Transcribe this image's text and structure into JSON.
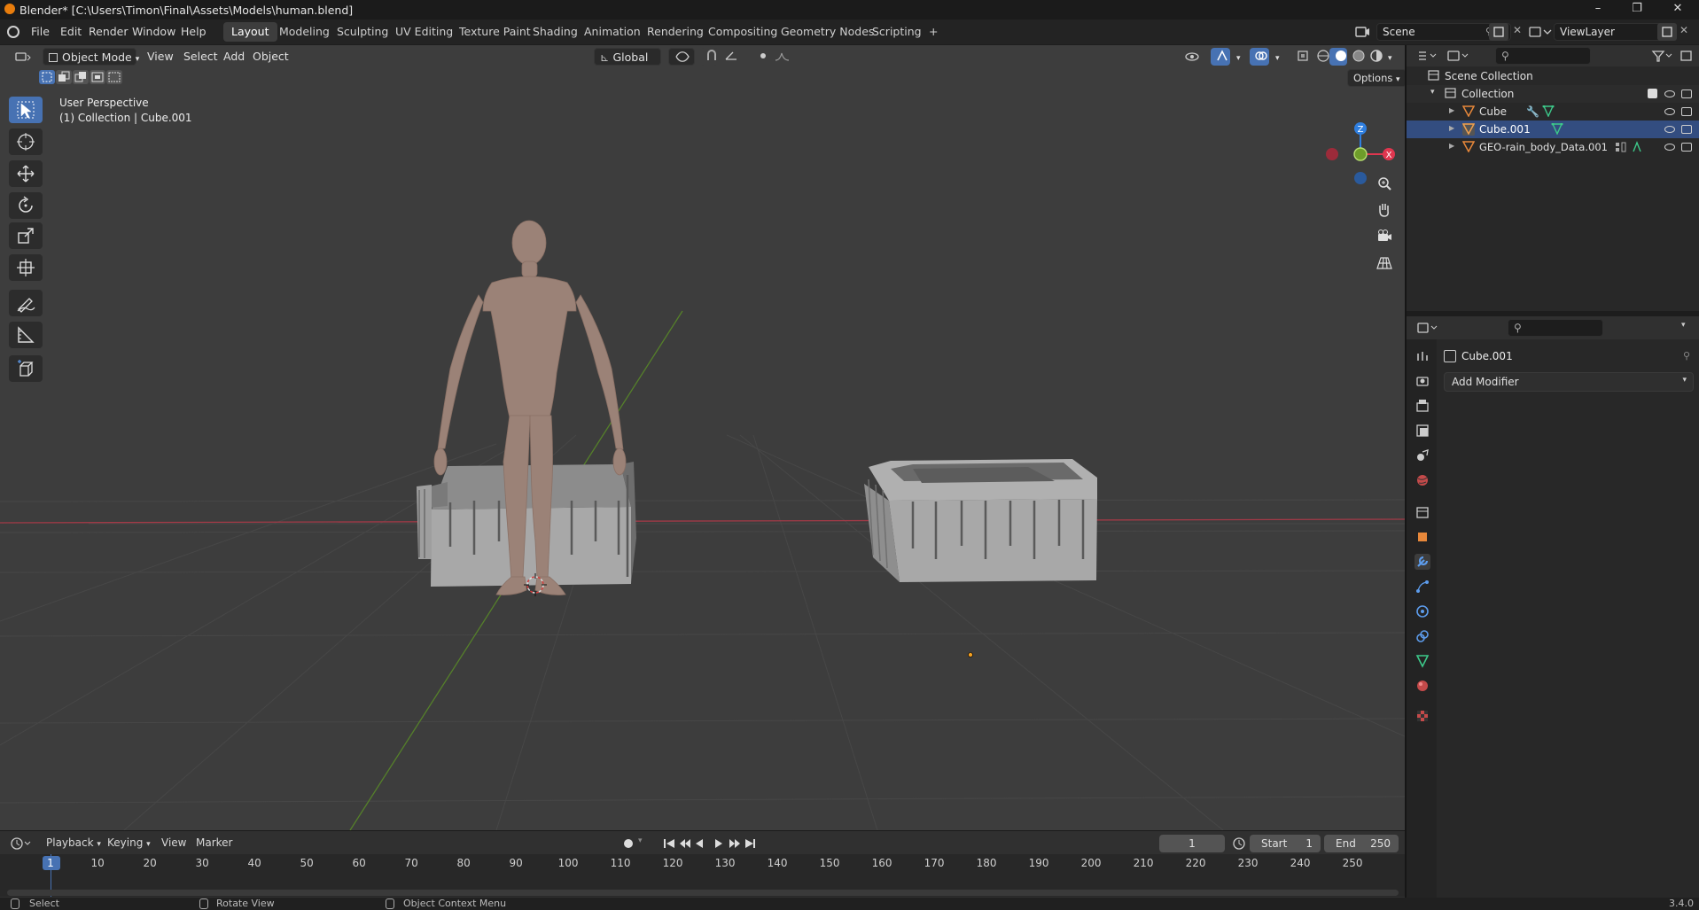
{
  "window": {
    "title": "Blender* [C:\\Users\\Timon\\Final\\Assets\\Models\\human.blend]",
    "controls": [
      "–",
      "❐",
      "✕"
    ]
  },
  "menu": [
    "File",
    "Edit",
    "Render",
    "Window",
    "Help"
  ],
  "workspaces": {
    "tabs": [
      "Layout",
      "Modeling",
      "Sculpting",
      "UV Editing",
      "Texture Paint",
      "Shading",
      "Animation",
      "Rendering",
      "Compositing",
      "Geometry Nodes",
      "Scripting"
    ],
    "active": "Layout",
    "add": "+"
  },
  "scene": {
    "name": "Scene",
    "view_layer": "ViewLayer"
  },
  "viewport_header": {
    "mode": "Object Mode",
    "menus": [
      "View",
      "Select",
      "Add",
      "Object"
    ],
    "orientation": "Global",
    "options": "Options"
  },
  "viewport": {
    "perspective": "User Perspective",
    "context": "(1) Collection | Cube.001",
    "gizmo": {
      "z": "Z",
      "y": "Y",
      "x": "X"
    }
  },
  "outliner": {
    "root": "Scene Collection",
    "collection": "Collection",
    "items": [
      "Cube",
      "Cube.001",
      "GEO-rain_body_Data.001"
    ]
  },
  "properties": {
    "object": "Cube.001",
    "add_modifier": "Add Modifier"
  },
  "timeline": {
    "menus": [
      "Playback",
      "Keying",
      "View",
      "Marker"
    ],
    "current_frame": "1",
    "start_label": "Start",
    "start": "1",
    "end_label": "End",
    "end": "250",
    "ruler": [
      "1",
      "10",
      "20",
      "30",
      "40",
      "50",
      "60",
      "70",
      "80",
      "90",
      "100",
      "110",
      "120",
      "130",
      "140",
      "150",
      "160",
      "170",
      "180",
      "190",
      "200",
      "210",
      "220",
      "230",
      "240",
      "250"
    ]
  },
  "status": {
    "select": "Select",
    "rotate": "Rotate View",
    "context_menu": "Object Context Menu",
    "version": "3.4.0"
  },
  "colors": {
    "accent": "#4772b3",
    "x_axis": "#e0364f",
    "y_axis": "#6e9d2a",
    "z_axis": "#2f7fe0",
    "blender_orange": "#e87d0d"
  }
}
